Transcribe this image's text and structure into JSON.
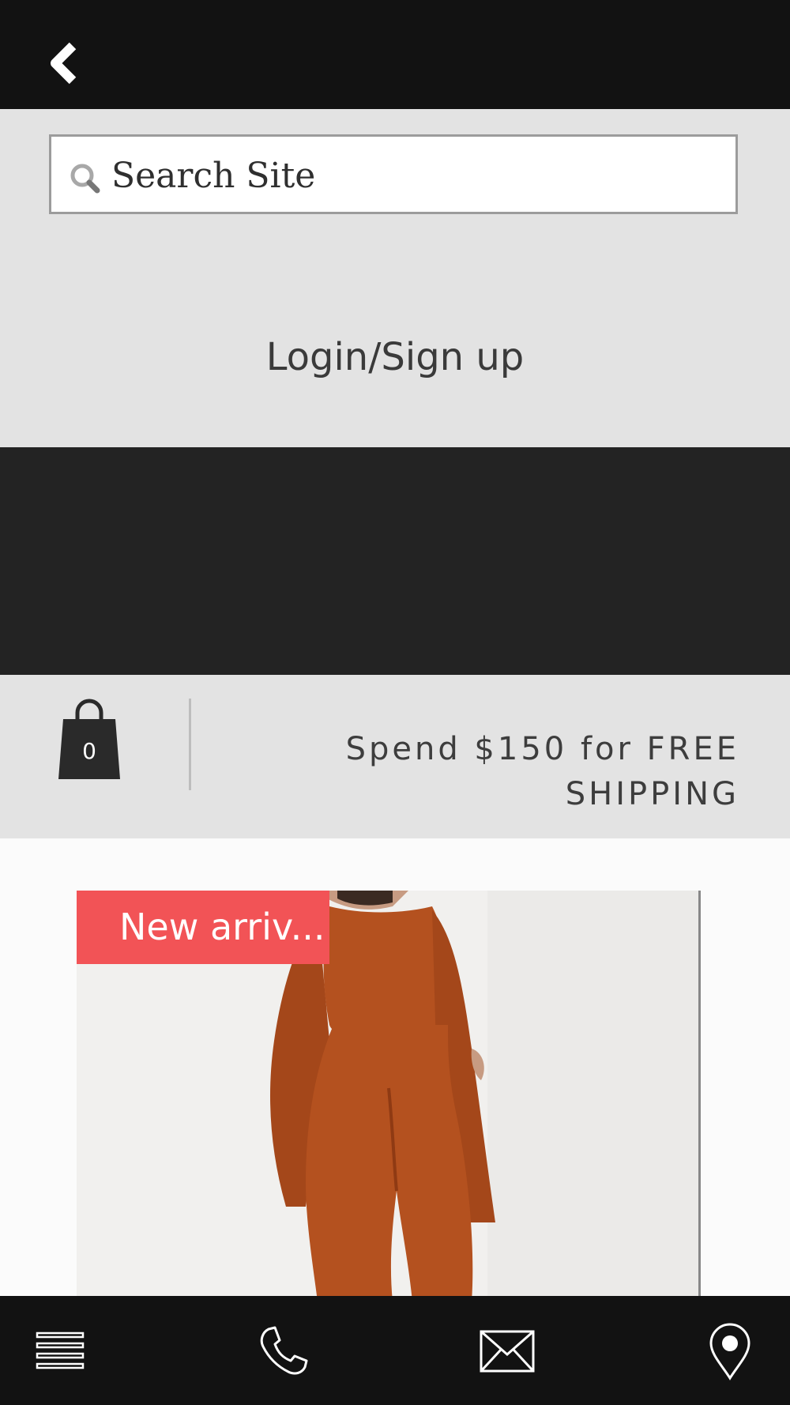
{
  "header": {
    "back_icon": "chevron-left-icon"
  },
  "search": {
    "placeholder": "Search Site",
    "icon": "search-icon"
  },
  "account": {
    "login_label": "Login/Sign up"
  },
  "cart": {
    "icon": "shopping-bag-icon",
    "count": "0"
  },
  "promo": {
    "line1": "Spend $150 for FREE",
    "line2": "SHIPPING"
  },
  "product": {
    "badge": "New arriv..."
  },
  "bottom_nav": {
    "items": [
      {
        "icon": "menu-icon"
      },
      {
        "icon": "phone-icon"
      },
      {
        "icon": "mail-icon"
      },
      {
        "icon": "location-pin-icon"
      }
    ]
  },
  "colors": {
    "topbar": "#121212",
    "band": "#e3e3e3",
    "dark_band": "#232323",
    "badge": "#f25356",
    "product_garment": "#b4511f"
  }
}
